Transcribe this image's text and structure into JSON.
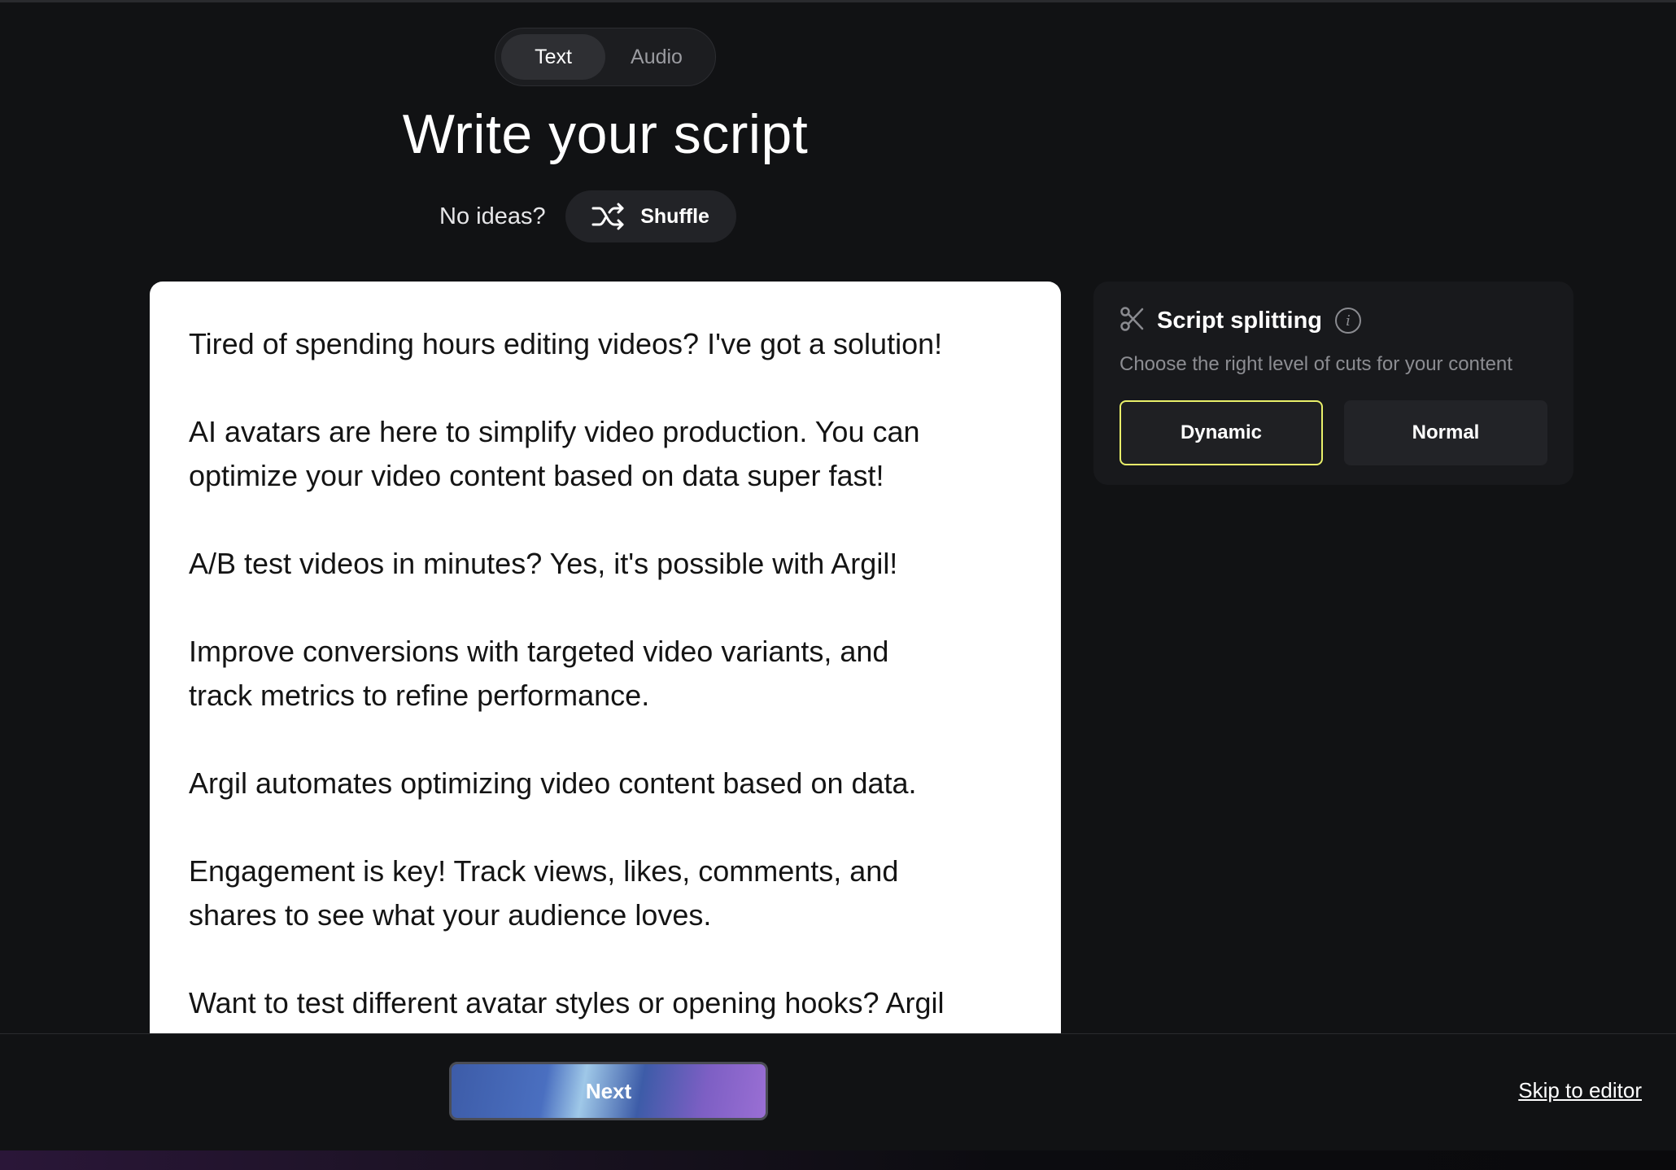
{
  "mode_toggle": {
    "tabs": [
      "Text",
      "Audio"
    ],
    "active": "Text"
  },
  "page_title": "Write your script",
  "ideas": {
    "prompt": "No ideas?",
    "shuffle_label": "Shuffle"
  },
  "script": {
    "paragraphs": [
      "Tired of spending hours editing videos? I've got a solution!",
      "AI avatars are here to simplify video production. You can\noptimize your video content based on data super fast!",
      "A/B test videos in minutes? Yes, it's possible with Argil!",
      "Improve conversions with targeted video variants, and\ntrack metrics to refine performance.",
      "Argil automates optimizing video content based on data.",
      "Engagement is key! Track views, likes, comments, and\nshares to see what your audience loves.",
      "Want to test different avatar styles or opening hooks? Argil"
    ]
  },
  "script_splitting": {
    "title": "Script splitting",
    "subtitle": "Choose the right level of cuts for your content",
    "options": [
      "Dynamic",
      "Normal"
    ],
    "selected": "Dynamic",
    "accent_color": "#e9f06a"
  },
  "footer": {
    "next_label": "Next",
    "skip_label": "Skip to editor"
  },
  "icons": {
    "shuffle": "shuffle-icon",
    "scissors": "scissors-icon",
    "info": "info-icon"
  }
}
